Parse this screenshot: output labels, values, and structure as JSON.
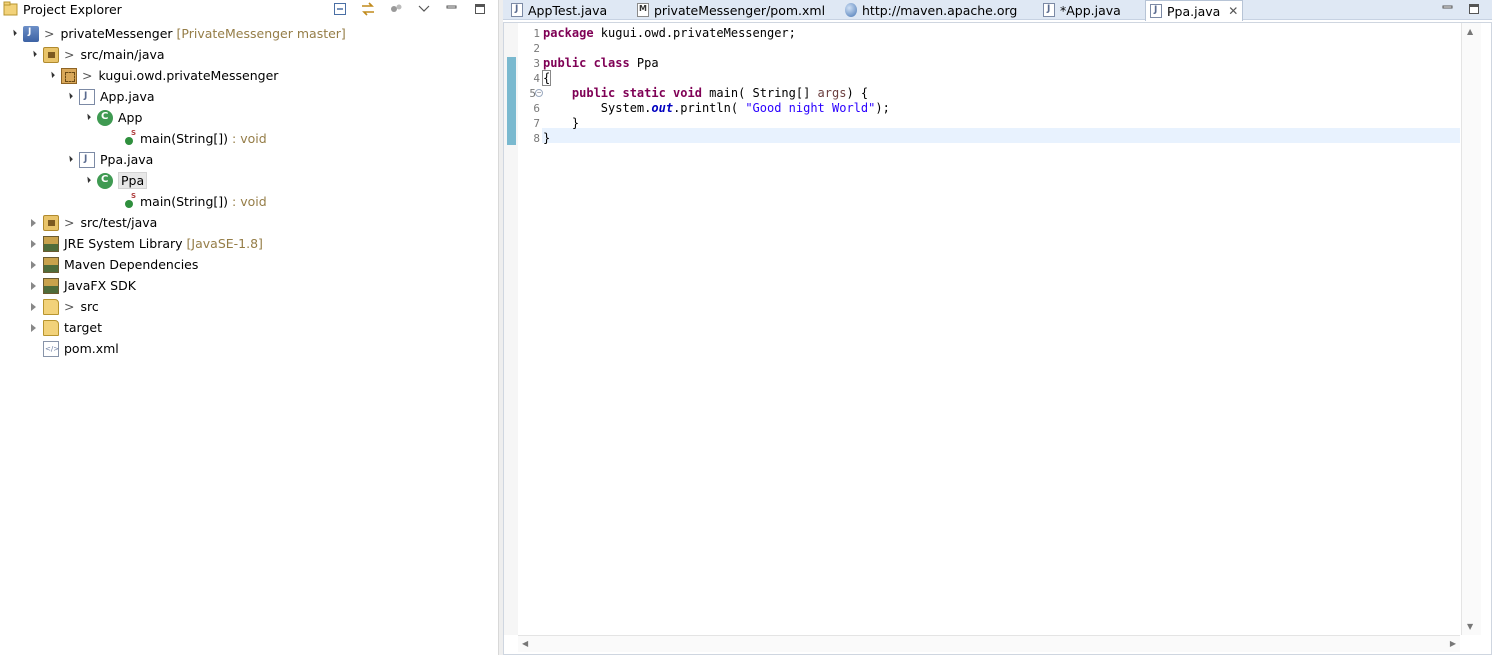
{
  "explorer": {
    "title": "Project Explorer",
    "toolbar": [
      "collapse-all",
      "link-with-editor",
      "filter",
      "view-menu",
      "minimize",
      "maximize"
    ],
    "tree": [
      {
        "label": "privateMessenger",
        "prefix": ">",
        "decoration": "[PrivateMessenger master]",
        "icon": "project-icon",
        "depth": 0,
        "state": "open"
      },
      {
        "label": "src/main/java",
        "prefix": ">",
        "decoration": "",
        "icon": "source-folder-icon",
        "depth": 1,
        "state": "open"
      },
      {
        "label": "kugui.owd.privateMessenger",
        "prefix": ">",
        "decoration": "",
        "icon": "package-icon",
        "depth": 2,
        "state": "open"
      },
      {
        "label": "App.java",
        "prefix": "",
        "decoration": "",
        "icon": "java-file-icon",
        "depth": 3,
        "state": "open"
      },
      {
        "label": "App",
        "prefix": "",
        "decoration": "",
        "icon": "class-icon",
        "depth": 4,
        "state": "open"
      },
      {
        "label": "main(String[])",
        "prefix": "",
        "decoration": ": void",
        "icon": "static-method-icon",
        "depth": 5,
        "state": "leaf"
      },
      {
        "label": "Ppa.java",
        "prefix": "",
        "decoration": "",
        "icon": "java-file-icon",
        "depth": 3,
        "state": "open"
      },
      {
        "label": "Ppa",
        "prefix": "",
        "decoration": "",
        "icon": "class-icon",
        "depth": 4,
        "state": "open",
        "selected": true
      },
      {
        "label": "main(String[])",
        "prefix": "",
        "decoration": ": void",
        "icon": "static-method-icon",
        "depth": 5,
        "state": "leaf"
      },
      {
        "label": "src/test/java",
        "prefix": ">",
        "decoration": "",
        "icon": "source-folder-icon",
        "depth": 1,
        "state": "closed"
      },
      {
        "label": "JRE System Library",
        "prefix": "",
        "decoration": "[JavaSE-1.8]",
        "icon": "library-icon",
        "depth": 1,
        "state": "closed"
      },
      {
        "label": "Maven Dependencies",
        "prefix": "",
        "decoration": "",
        "icon": "library-icon",
        "depth": 1,
        "state": "closed"
      },
      {
        "label": "JavaFX SDK",
        "prefix": "",
        "decoration": "",
        "icon": "library-icon",
        "depth": 1,
        "state": "closed"
      },
      {
        "label": "src",
        "prefix": ">",
        "decoration": "",
        "icon": "folder-icon",
        "depth": 1,
        "state": "closed"
      },
      {
        "label": "target",
        "prefix": "",
        "decoration": "",
        "icon": "folder-icon",
        "depth": 1,
        "state": "closed"
      },
      {
        "label": "pom.xml",
        "prefix": "",
        "decoration": "",
        "icon": "xml-file-icon",
        "depth": 1,
        "state": "leaf"
      }
    ]
  },
  "editor": {
    "tabs": [
      {
        "label": "AppTest.java",
        "icon": "java-file-icon",
        "active": false
      },
      {
        "label": "privateMessenger/pom.xml",
        "icon": "maven-pom-icon",
        "active": false
      },
      {
        "label": "http://maven.apache.org",
        "icon": "web-browser-icon",
        "active": false
      },
      {
        "label": "*App.java",
        "icon": "java-file-icon",
        "active": false
      },
      {
        "label": "Ppa.java",
        "icon": "java-file-icon",
        "active": true
      }
    ],
    "line_numbers": [
      "1",
      "2",
      "3",
      "4",
      "5",
      "6",
      "7",
      "8"
    ],
    "code": {
      "l1_kw": "package",
      "l1_rest": " kugui.owd.privateMessenger;",
      "l3_kw": "public class",
      "l3_rest": " Ppa",
      "l4_brace": "{",
      "l5_indent": "    ",
      "l5_kw": "public static void",
      "l5_mid": " main( String[] ",
      "l5_param": "args",
      "l5_end": ") {",
      "l6_indent": "        ",
      "l6_a": "System.",
      "l6_field": "out",
      "l6_b": ".println( ",
      "l6_str": "\"Good night World\"",
      "l6_end": ");",
      "l7": "    }",
      "l8": "}"
    },
    "colors": {
      "keyword": "#7f0055",
      "string": "#2a00ff",
      "field": "#0000c0",
      "change_bar": "#7ab9cf",
      "current_line": "#e8f2fe"
    }
  }
}
